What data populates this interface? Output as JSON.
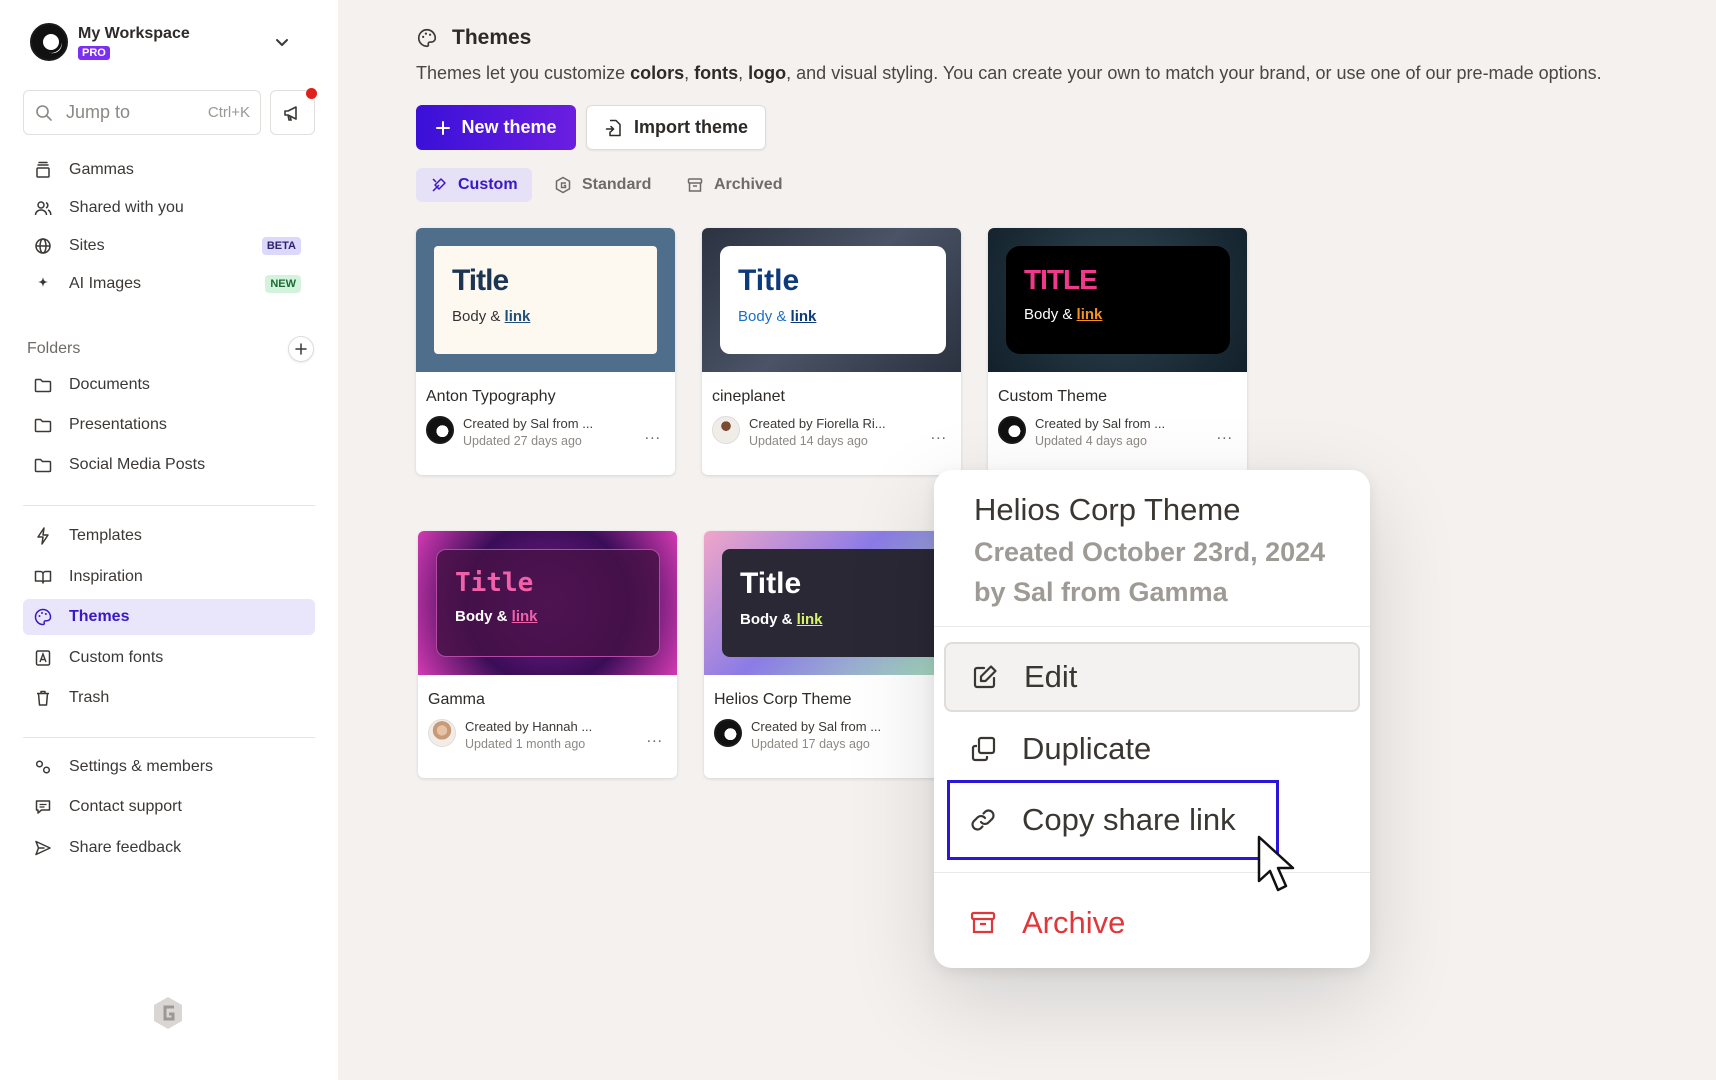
{
  "workspace": {
    "name": "My Workspace",
    "plan_badge": "PRO"
  },
  "search": {
    "placeholder": "Jump to",
    "shortcut": "Ctrl+K"
  },
  "nav_main": [
    {
      "label": "Gammas",
      "icon": "stack-icon"
    },
    {
      "label": "Shared with you",
      "icon": "users-icon"
    },
    {
      "label": "Sites",
      "icon": "globe-icon",
      "badge": "BETA"
    },
    {
      "label": "AI Images",
      "icon": "sparkle-icon",
      "badge": "NEW"
    }
  ],
  "folders": {
    "header": "Folders",
    "items": [
      {
        "label": "Documents"
      },
      {
        "label": "Presentations"
      },
      {
        "label": "Social Media Posts"
      }
    ]
  },
  "nav_secondary": [
    {
      "label": "Templates",
      "icon": "bolt-icon"
    },
    {
      "label": "Inspiration",
      "icon": "book-icon"
    },
    {
      "label": "Themes",
      "icon": "palette-icon",
      "active": true
    },
    {
      "label": "Custom fonts",
      "icon": "font-icon"
    },
    {
      "label": "Trash",
      "icon": "trash-icon"
    }
  ],
  "nav_footer": [
    {
      "label": "Settings & members",
      "icon": "gears-icon"
    },
    {
      "label": "Contact support",
      "icon": "chat-icon"
    },
    {
      "label": "Share feedback",
      "icon": "send-icon"
    }
  ],
  "page": {
    "title": "Themes",
    "desc_pre": "Themes let you customize ",
    "desc_b1": "colors",
    "desc_sep1": ", ",
    "desc_b2": "fonts",
    "desc_sep2": ", ",
    "desc_b3": "logo",
    "desc_post": ", and visual styling. You can create your own to match your brand, or use one of our pre-made options.",
    "new_theme": "New theme",
    "import_theme": "Import theme",
    "tabs": [
      {
        "label": "Custom",
        "active": true
      },
      {
        "label": "Standard"
      },
      {
        "label": "Archived"
      }
    ]
  },
  "cards": [
    {
      "name": "Anton Typography",
      "preview_title": "Title",
      "preview_body": "Body &",
      "preview_link": "link",
      "created_by": "Created by Sal from ...",
      "updated": "Updated 27 days ago"
    },
    {
      "name": "cineplanet",
      "preview_title": "Title",
      "preview_body": "Body &",
      "preview_link": "link",
      "created_by": "Created by Fiorella Ri...",
      "updated": "Updated 14 days ago"
    },
    {
      "name": "Custom Theme",
      "preview_title": "TITLE",
      "preview_body": "Body &",
      "preview_link": "link",
      "created_by": "Created by Sal from ...",
      "updated": "Updated 4 days ago"
    },
    {
      "name": "Gamma",
      "preview_title": "Title",
      "preview_body": "Body &",
      "preview_link": "link",
      "created_by": "Created by Hannah ...",
      "updated": "Updated 1 month ago"
    },
    {
      "name": "Helios Corp Theme",
      "preview_title": "Title",
      "preview_body": "Body &",
      "preview_link": "link",
      "created_by": "Created by Sal from ...",
      "updated": "Updated 17 days ago"
    }
  ],
  "card_more": "...",
  "context_menu": {
    "title": "Helios Corp Theme",
    "subtitle": "Created October 23rd, 2024 by Sal from Gamma",
    "items": [
      {
        "label": "Edit",
        "icon": "edit-icon"
      },
      {
        "label": "Duplicate",
        "icon": "duplicate-icon"
      },
      {
        "label": "Copy share link",
        "icon": "link-icon"
      },
      {
        "label": "Archive",
        "icon": "archive-icon"
      }
    ]
  },
  "colors": {
    "accent": "#3a18c4",
    "danger": "#e0373b",
    "primary_button": "#4a14dc"
  }
}
